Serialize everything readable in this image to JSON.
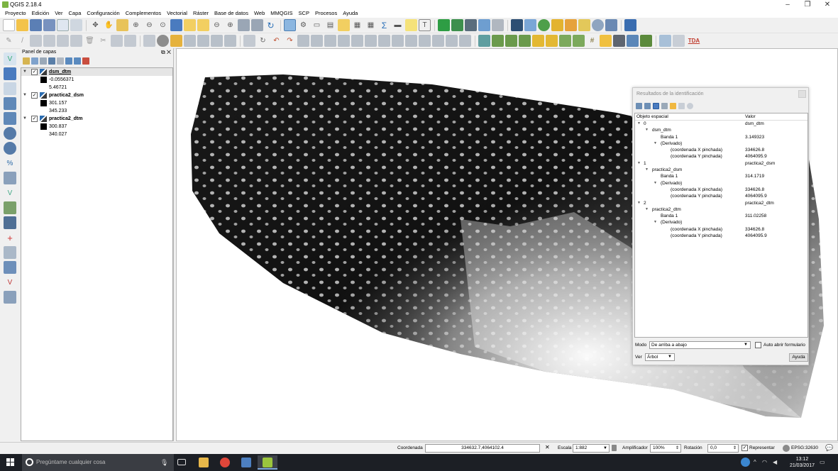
{
  "window": {
    "title": "QGIS 2.18.4",
    "min": "–",
    "max": "❐",
    "close": "✕"
  },
  "menu": [
    "Proyecto",
    "Edición",
    "Ver",
    "Capa",
    "Configuración",
    "Complementos",
    "Vectorial",
    "Ráster",
    "Base de datos",
    "Web",
    "MMQGIS",
    "SCP",
    "Procesos",
    "Ayuda"
  ],
  "toolbar_extra": {
    "tda_label": "TDA"
  },
  "layers_panel": {
    "title": "Panel de capas",
    "layers": [
      {
        "name": "dsm_dtm",
        "min": "-0.0556371",
        "max": "5.46721",
        "checked": "✓"
      },
      {
        "name": "practica2_dsm",
        "min": "301.157",
        "max": "345.233",
        "checked": "✓"
      },
      {
        "name": "practica2_dtm",
        "min": "300.837",
        "max": "340.027",
        "checked": "✓"
      }
    ]
  },
  "identify": {
    "title": "Resultados de la identificación",
    "col_feature": "Objeto espacial",
    "col_value": "Valor",
    "rows": [
      {
        "key": "0",
        "value": "dsm_dtm"
      },
      {
        "key": "dsm_dtm",
        "value": ""
      },
      {
        "key": "Banda 1",
        "value": "3.149323"
      },
      {
        "key": "(Derivado)",
        "value": ""
      },
      {
        "key": "(coordenada X pinchada)",
        "value": "334626.8"
      },
      {
        "key": "(coordenada Y pinchada)",
        "value": "4064095.9"
      },
      {
        "key": "1",
        "value": "practica2_dsm"
      },
      {
        "key": "practica2_dsm",
        "value": ""
      },
      {
        "key": "Banda 1",
        "value": "314.1719"
      },
      {
        "key": "(Derivado)",
        "value": ""
      },
      {
        "key": "(coordenada X pinchada)",
        "value": "334626.8"
      },
      {
        "key": "(coordenada Y pinchada)",
        "value": "4064095.9"
      },
      {
        "key": "2",
        "value": "practica2_dtm"
      },
      {
        "key": "practica2_dtm",
        "value": ""
      },
      {
        "key": "Banda 1",
        "value": "311.02258"
      },
      {
        "key": "(Derivado)",
        "value": ""
      },
      {
        "key": "(coordenada X pinchada)",
        "value": "334626.8"
      },
      {
        "key": "(coordenada Y pinchada)",
        "value": "4064095.9"
      }
    ],
    "mode_label": "Modo",
    "mode_value": "De arriba a abajo",
    "auto_open_label": "Auto abrir formulario",
    "view_label": "Ver",
    "view_value": "Árbol",
    "help_label": "Ayuda"
  },
  "status": {
    "coord_label": "Coordenada",
    "coord_value": "334632.7,4064102.4",
    "scale_label": "Escala",
    "scale_value": "1:882",
    "magnifier_label": "Amplificador",
    "magnifier_value": "100%",
    "rotation_label": "Rotación",
    "rotation_value": "0,0",
    "render_label": "Representar",
    "crs_label": "EPSG:32630"
  },
  "taskbar": {
    "search_placeholder": "Pregúntame cualquier cosa",
    "time": "13:12",
    "date": "21/03/2017"
  }
}
